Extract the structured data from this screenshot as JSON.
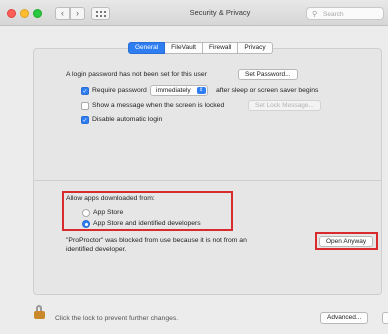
{
  "window": {
    "title": "Security & Privacy"
  },
  "search": {
    "placeholder": "Search"
  },
  "tabs": [
    {
      "label": "General",
      "active": true
    },
    {
      "label": "FileVault",
      "active": false
    },
    {
      "label": "Firewall",
      "active": false
    },
    {
      "label": "Privacy",
      "active": false
    }
  ],
  "login": {
    "text": "A login password has not been set for this user",
    "set_password_button": "Set Password...",
    "require_password": {
      "checked": true,
      "label": "Require password",
      "dropdown_value": "immediately",
      "suffix": "after sleep or screen saver begins"
    },
    "show_message": {
      "checked": false,
      "label": "Show a message when the screen is locked",
      "button": "Set Lock Message..."
    },
    "disable_auto_login": {
      "checked": true,
      "label": "Disable automatic login"
    }
  },
  "downloads": {
    "heading": "Allow apps downloaded from:",
    "options": [
      {
        "label": "App Store",
        "selected": false
      },
      {
        "label": "App Store and identified developers",
        "selected": true
      }
    ],
    "blocked_message_line1": "\"ProProctor\" was blocked from use because it is not from an",
    "blocked_message_line2": "identified developer.",
    "open_anyway_button": "Open Anyway"
  },
  "footer": {
    "lock_text": "Click the lock to prevent further changes.",
    "advanced_button": "Advanced..."
  },
  "colors": {
    "accent": "#2f7ef1",
    "highlight_box": "#d92b2b",
    "lock": "#c9892a"
  },
  "icons": [
    "close-light",
    "minimize-light",
    "zoom-light",
    "chevron-left-icon",
    "chevron-right-icon",
    "grid-icon",
    "search-icon",
    "lock-icon"
  ]
}
